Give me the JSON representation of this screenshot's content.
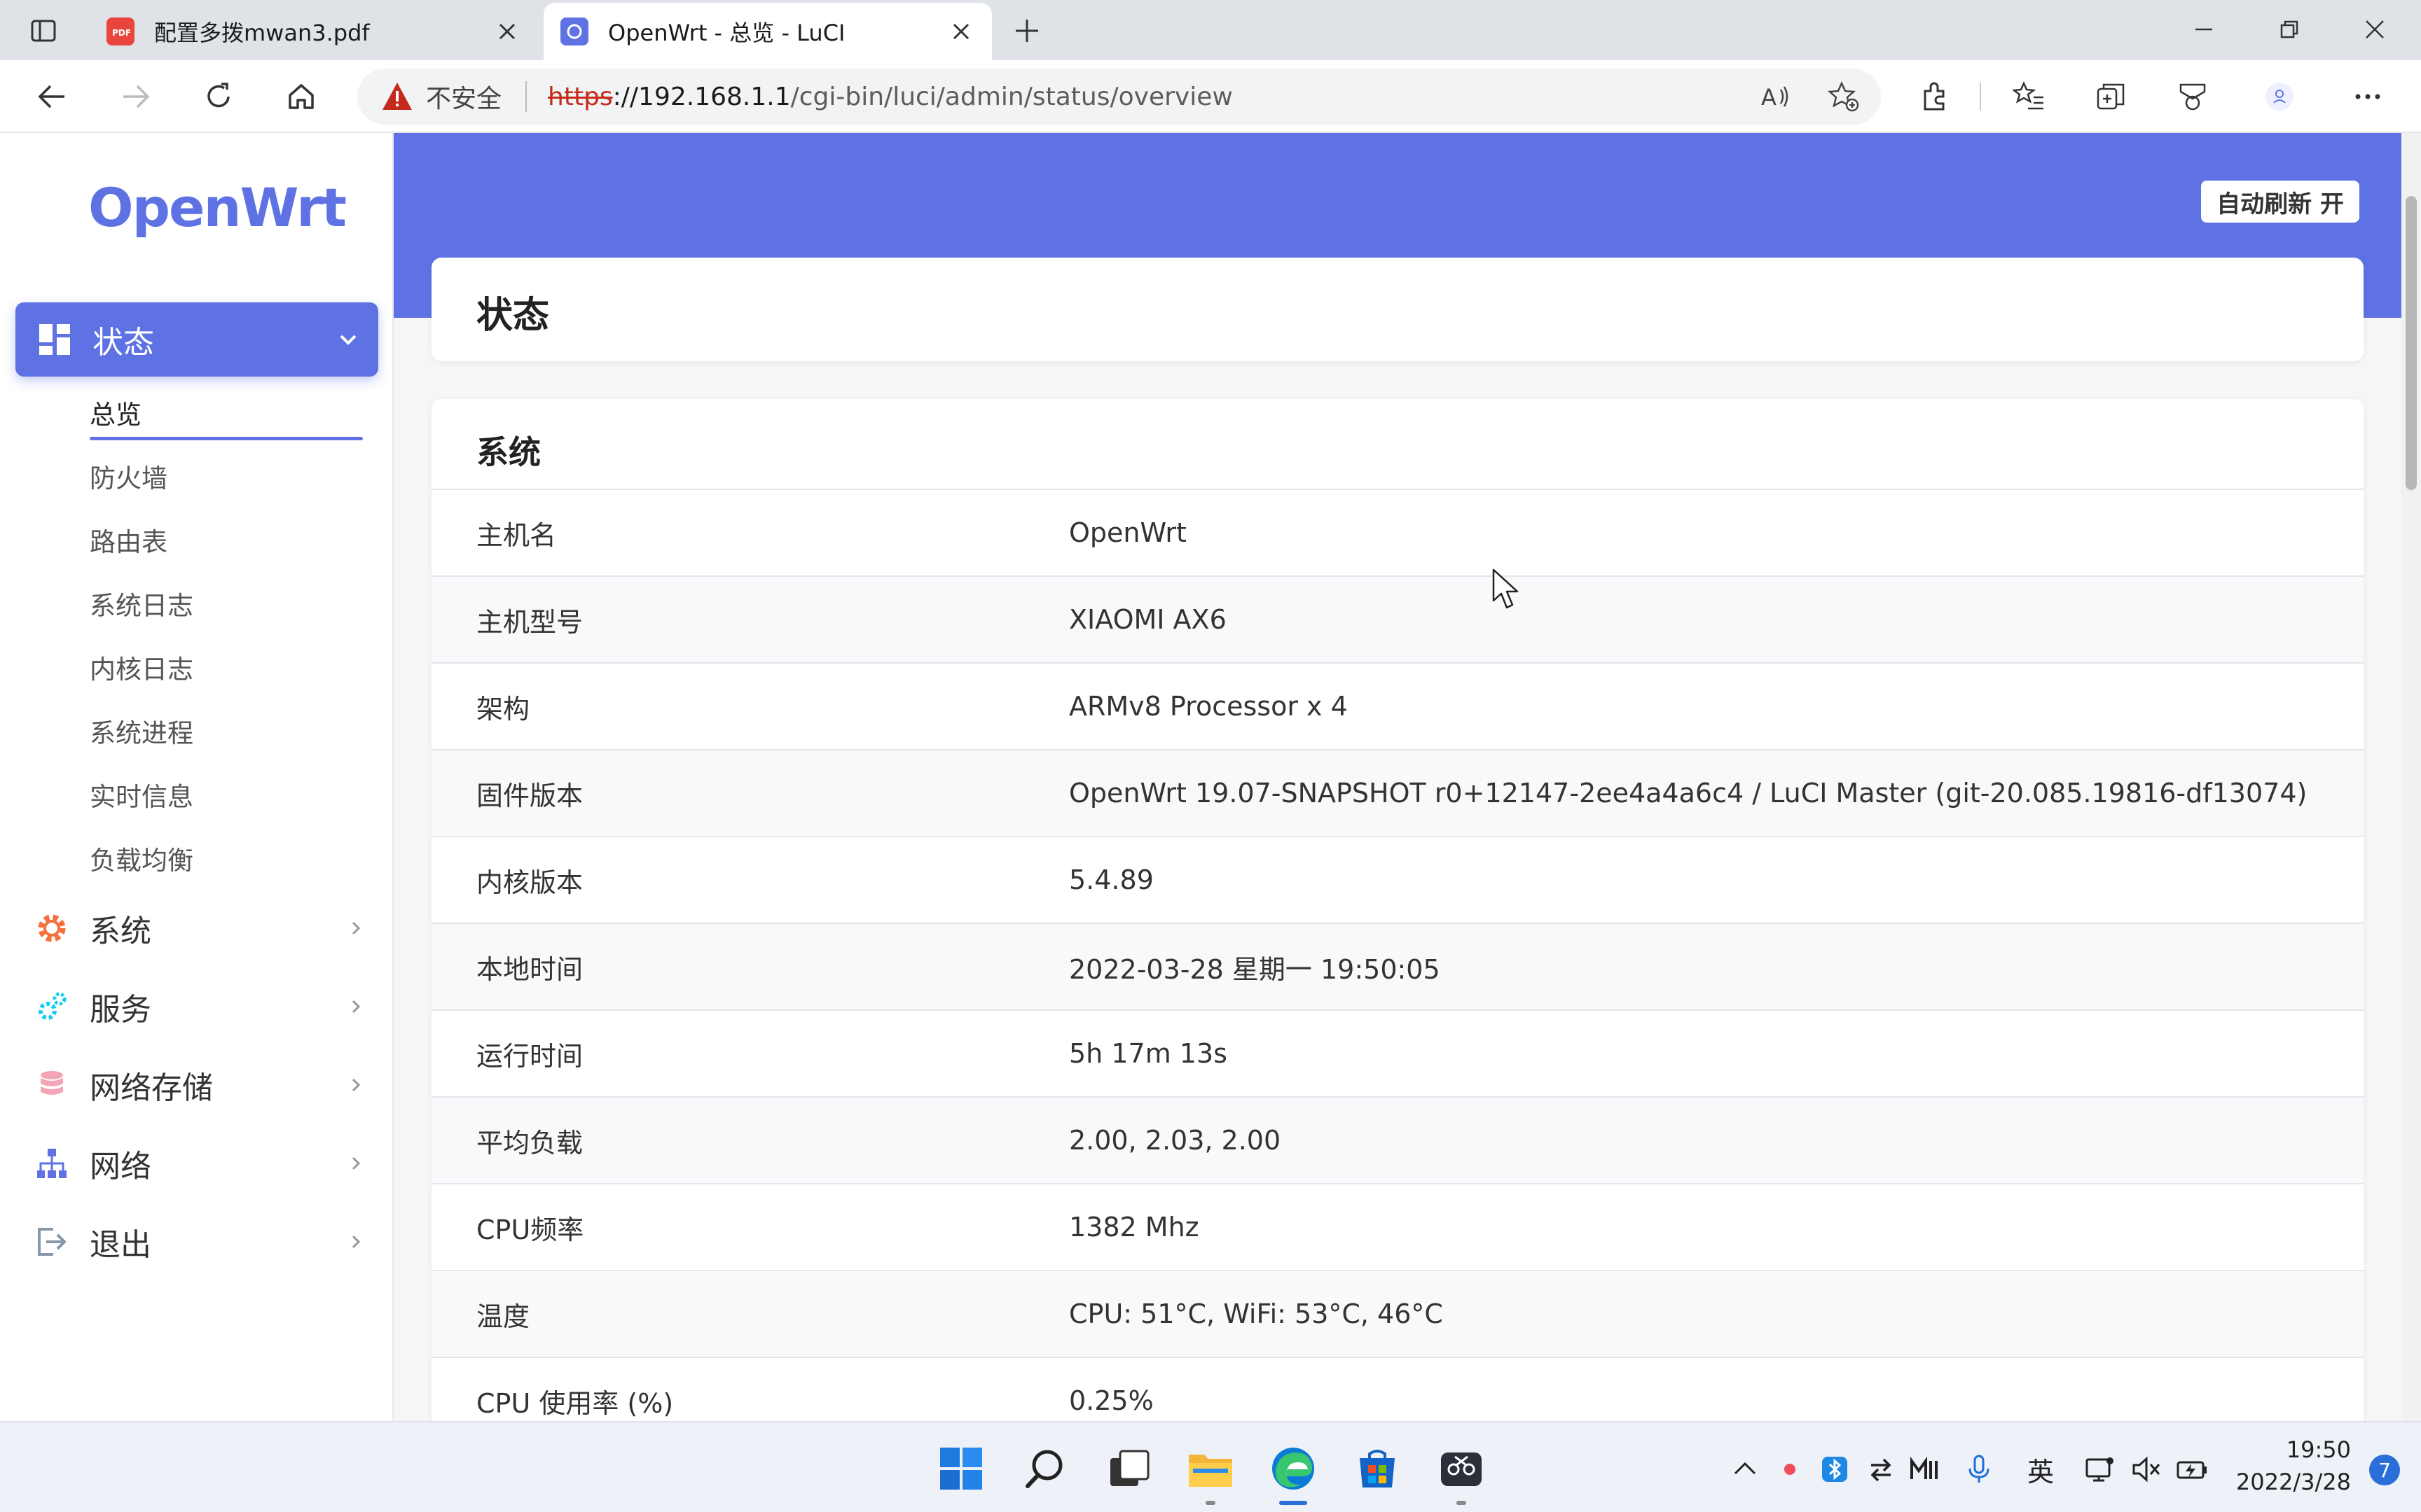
{
  "browser": {
    "tabs": [
      {
        "title": "配置多拨mwan3.pdf",
        "active": false
      },
      {
        "title": "OpenWrt - 总览 - LuCI",
        "active": true
      }
    ],
    "address": {
      "insecure_label": "不安全",
      "url_scheme": "https",
      "url_host": "://192.168.1.1",
      "url_path": "/cgi-bin/luci/admin/status/overview"
    }
  },
  "sidebar": {
    "logo": "OpenWrt",
    "status_menu": "状态",
    "status_submenu": [
      "总览",
      "防火墙",
      "路由表",
      "系统日志",
      "内核日志",
      "系统进程",
      "实时信息",
      "负载均衡"
    ],
    "menus": [
      "系统",
      "服务",
      "网络存储",
      "网络",
      "退出"
    ]
  },
  "header": {
    "autorefresh": "自动刷新 开",
    "page_title": "状态"
  },
  "system_card": {
    "title": "系统",
    "rows": [
      {
        "key": "主机名",
        "value": "OpenWrt"
      },
      {
        "key": "主机型号",
        "value": "XIAOMI AX6"
      },
      {
        "key": "架构",
        "value": "ARMv8 Processor x 4"
      },
      {
        "key": "固件版本",
        "value": "OpenWrt 19.07-SNAPSHOT r0+12147-2ee4a4a6c4 / LuCI Master (git-20.085.19816-df13074)"
      },
      {
        "key": "内核版本",
        "value": "5.4.89"
      },
      {
        "key": "本地时间",
        "value": "2022-03-28 星期一 19:50:05"
      },
      {
        "key": "运行时间",
        "value": "5h 17m 13s"
      },
      {
        "key": "平均负载",
        "value": "2.00, 2.03, 2.00"
      },
      {
        "key": "CPU频率",
        "value": "1382 Mhz"
      },
      {
        "key": "温度",
        "value": "CPU: 51°C, WiFi: 53°C, 46°C"
      },
      {
        "key": "CPU 使用率 (%)",
        "value": "0.25%"
      }
    ]
  },
  "taskbar": {
    "ime": "英",
    "time": "19:50",
    "date": "2022/3/28",
    "notifications": "7"
  },
  "colors": {
    "accent": "#5e72e4",
    "warning": "#c42b1c"
  }
}
